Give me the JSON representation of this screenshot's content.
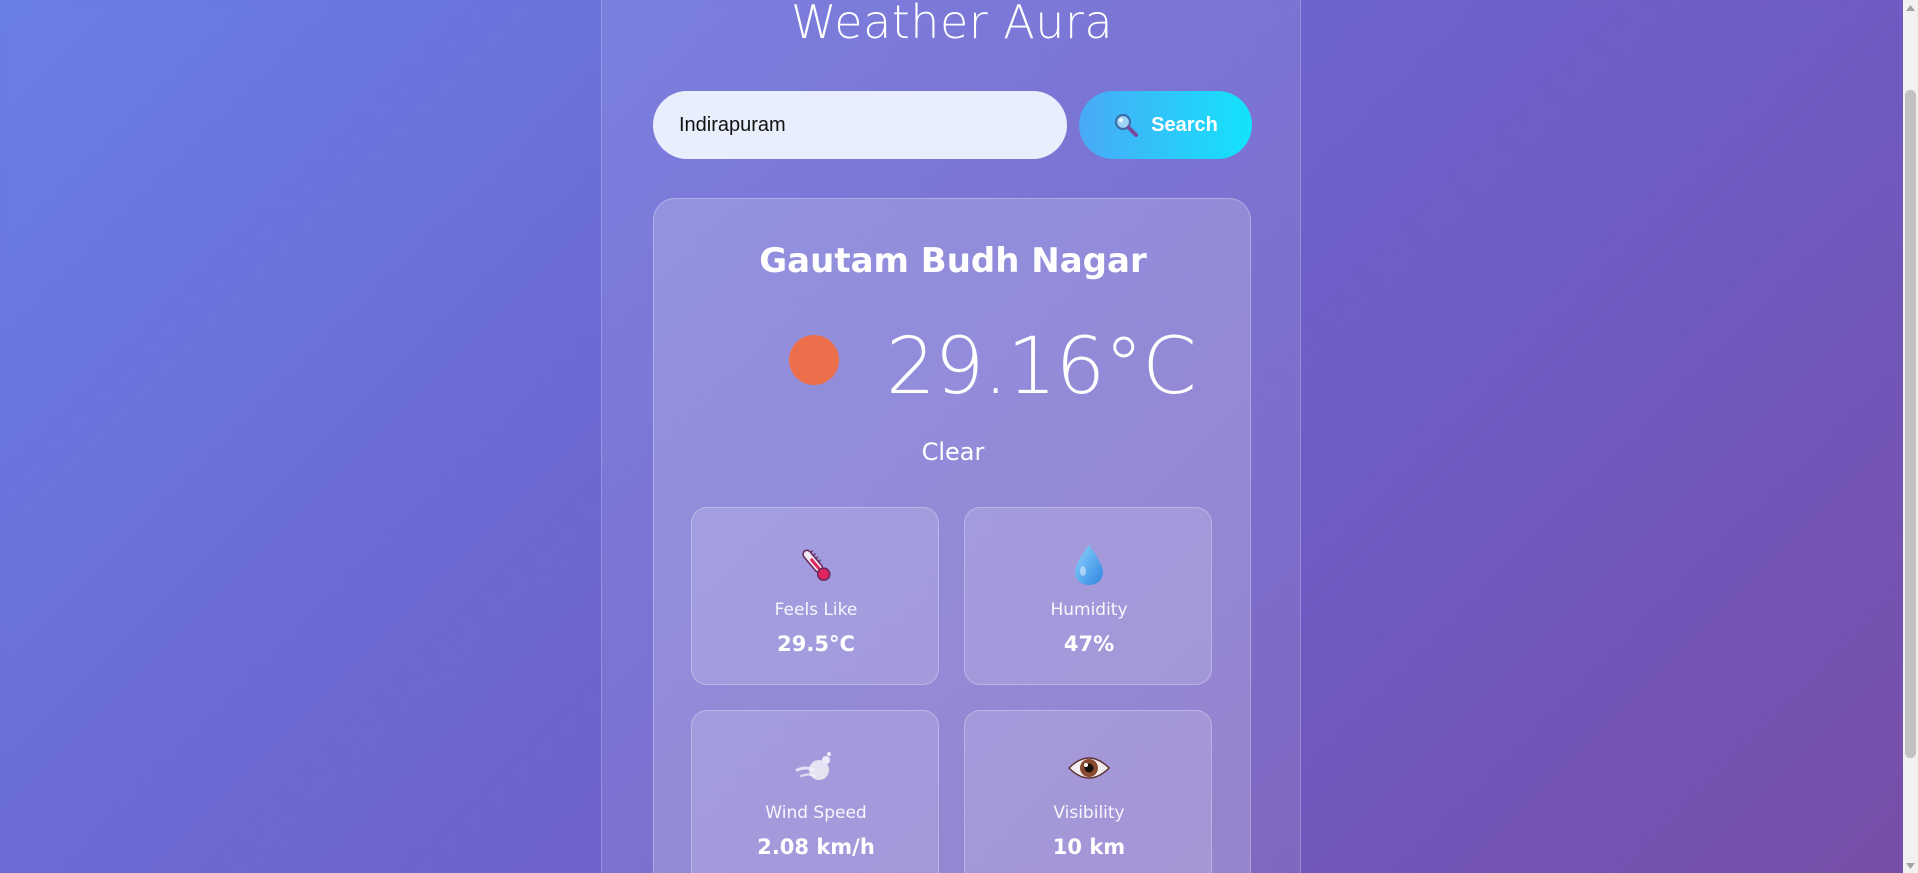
{
  "app": {
    "title": "Weather Aura"
  },
  "search": {
    "value": "Indirapuram",
    "button_label": "Search",
    "button_icon": "magnifier-icon"
  },
  "weather": {
    "city": "Gautam Budh Nagar",
    "temperature": "29.16°C",
    "condition": "Clear",
    "condition_icon": "sun-icon",
    "stats": {
      "feels_like": {
        "label": "Feels Like",
        "value": "29.5°C",
        "icon": "thermometer-icon"
      },
      "humidity": {
        "label": "Humidity",
        "value": "47%",
        "icon": "water-drop-icon"
      },
      "wind_speed": {
        "label": "Wind Speed",
        "value": "2.08 km/h",
        "icon": "wind-icon"
      },
      "visibility": {
        "label": "Visibility",
        "value": "10 km",
        "icon": "eye-icon"
      }
    }
  },
  "colors": {
    "background_start": "#6a7ee8",
    "background_end": "#764ea8",
    "search_button_start": "#4aa9f7",
    "search_button_end": "#13e3fb",
    "sun": "#ec6e4a",
    "input_background": "#e8eefb"
  }
}
